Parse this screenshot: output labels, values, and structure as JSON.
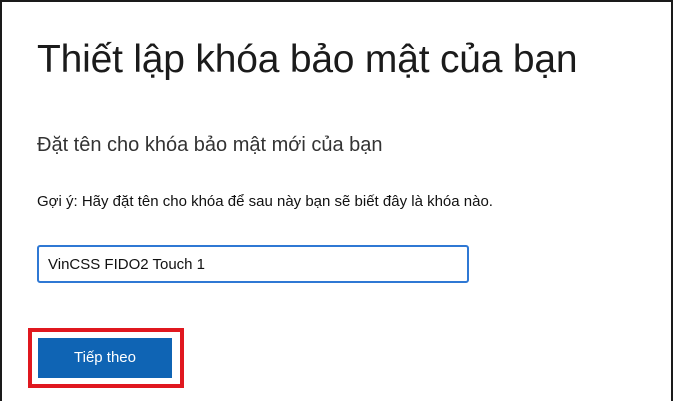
{
  "dialog": {
    "title": "Thiết lập khóa bảo mật của bạn",
    "subtitle": "Đặt tên cho khóa bảo mật mới của bạn",
    "hint": "Gợi ý: Hãy đặt tên cho khóa để sau này bạn sẽ biết đây là khóa nào.",
    "name_input": {
      "value": "VinCSS FIDO2 Touch 1"
    },
    "next_button_label": "Tiếp theo"
  },
  "colors": {
    "button_bg": "#0f64b4",
    "input_border": "#2f78d4",
    "highlight": "#e0181f"
  }
}
